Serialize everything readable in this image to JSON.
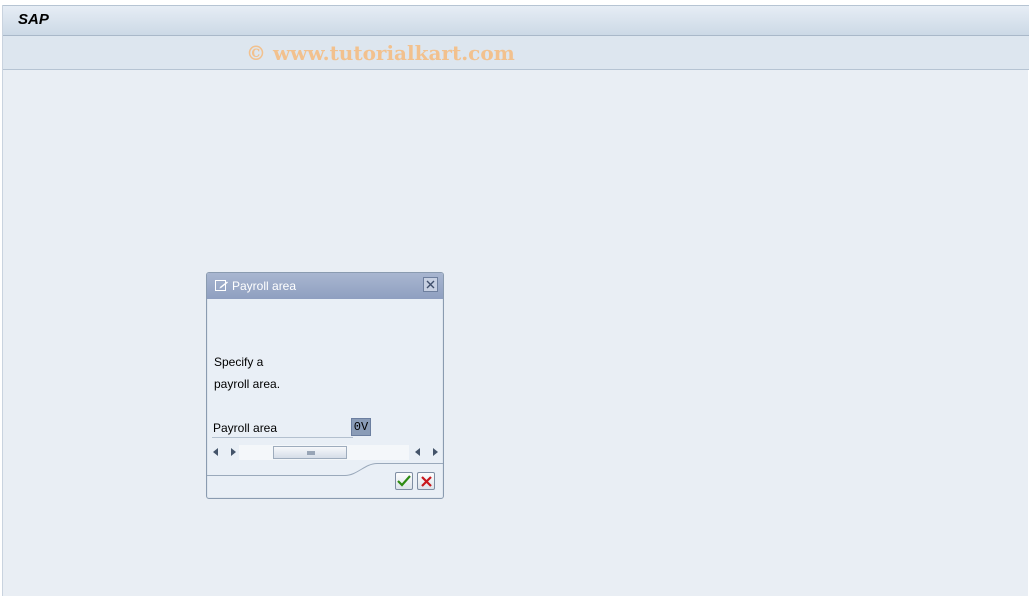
{
  "app": {
    "title": "SAP"
  },
  "watermark": {
    "text": "© www.tutorialkart.com"
  },
  "dialog": {
    "title": "Payroll area",
    "message_line1": "Specify a",
    "message_line2": "payroll area.",
    "field_label": "Payroll area",
    "field_value": "0V",
    "icons": {
      "header": "edit-dialog-icon",
      "close": "close-icon",
      "confirm": "checkmark-icon",
      "cancel": "cancel-x-icon"
    }
  },
  "colors": {
    "background": "#e9eef4",
    "dialog_header": "#8f9fc0",
    "confirm": "#2e8b12",
    "cancel": "#c8171c",
    "watermark": "#f2c18e"
  }
}
